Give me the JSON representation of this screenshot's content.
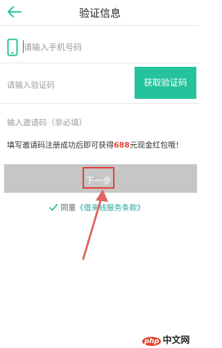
{
  "header": {
    "title": "验证信息",
    "back_icon": "back-arrow-icon"
  },
  "form": {
    "phone_placeholder": "请输入手机号码",
    "code_placeholder": "请输入验证码",
    "get_code_label": "获取验证码",
    "invite_placeholder": "输入邀请码（非必填）"
  },
  "promo": {
    "prefix": "填写邀请码注册成功后即可获得",
    "amount": "688",
    "suffix": "元现金红包哦！"
  },
  "actions": {
    "next_label": "下一步"
  },
  "agreement": {
    "prefix": "同意",
    "terms": "《借来钱服务条款》"
  },
  "watermark": {
    "badge": "php",
    "text": "中文网"
  },
  "colors": {
    "accent": "#26c29b",
    "highlight": "#e53a33",
    "disabled_button": "#c6c6c6"
  }
}
